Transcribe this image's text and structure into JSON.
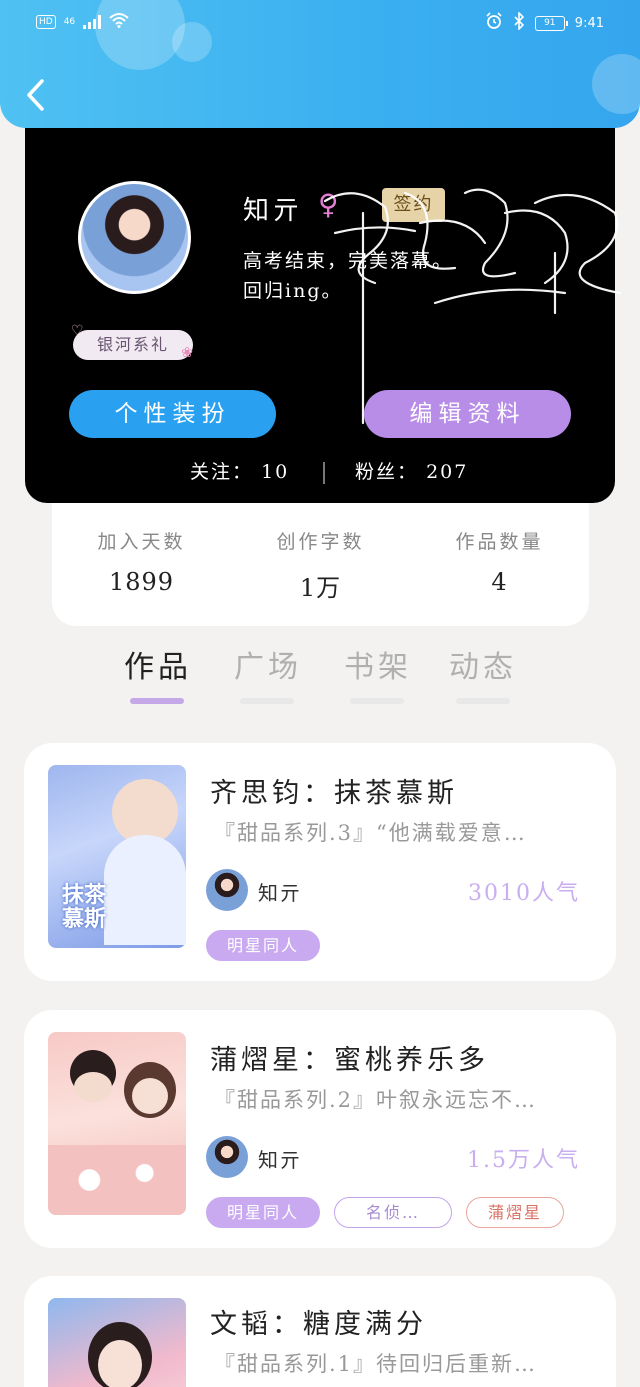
{
  "status_bar": {
    "network_label": "HD",
    "network_type": "46",
    "battery": "91",
    "time": "9:41"
  },
  "header": {
    "back_icon": "chevron-left-icon"
  },
  "profile": {
    "username": "知亓",
    "gender_icon": "female-icon",
    "signed_tag": "签约",
    "bio_line1": "高考结束，完美落幕。",
    "bio_line2": "回归ing。",
    "badge": "银河系礼",
    "dress_button": "个性装扮",
    "edit_button": "编辑资料",
    "following_label": "关注：",
    "following_count": "10",
    "fans_label": "粉丝：",
    "fans_count": "207"
  },
  "stats": [
    {
      "label": "加入天数",
      "value": "1899"
    },
    {
      "label": "创作字数",
      "value": "1万"
    },
    {
      "label": "作品数量",
      "value": "4"
    }
  ],
  "tabs": [
    {
      "label": "作品",
      "active": true
    },
    {
      "label": "广场",
      "active": false
    },
    {
      "label": "书架",
      "active": false
    },
    {
      "label": "动态",
      "active": false
    }
  ],
  "works": [
    {
      "title": "齐思钧：抹茶慕斯",
      "desc": "『甜品系列.3』“他满载爱意…",
      "author": "知亓",
      "popularity": "3010人气",
      "cover_text": "抹茶\n慕斯",
      "tags": [
        "明星同人"
      ]
    },
    {
      "title": "蒲熠星：蜜桃养乐多",
      "desc": "『甜品系列.2』叶叙永远忘不…",
      "author": "知亓",
      "popularity": "1.5万人气",
      "cover_text": "",
      "tags": [
        "明星同人",
        "名侦…",
        "蒲熠星"
      ]
    },
    {
      "title": "文韬：糖度满分",
      "desc": "『甜品系列.1』待回归后重新…",
      "author": "",
      "popularity": "",
      "cover_text": "",
      "tags": []
    }
  ],
  "colors": {
    "header_blue": "#3aaff0",
    "dress_button": "#2aa0f1",
    "edit_button": "#b88de8",
    "accent_purple": "#c9aaf0"
  }
}
